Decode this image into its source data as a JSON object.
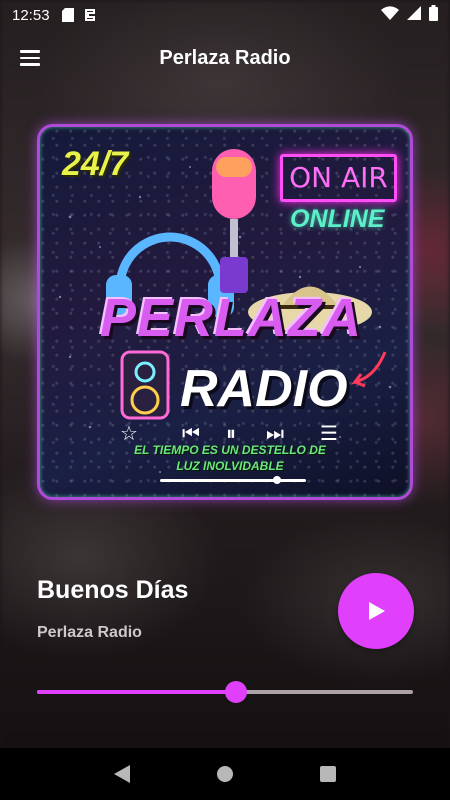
{
  "status_bar": {
    "time": "12:53",
    "icons": [
      "sd-card-icon",
      "sync-icon",
      "wifi-icon",
      "signal-icon",
      "battery-icon"
    ]
  },
  "app_bar": {
    "title": "Perlaza Radio",
    "menu_icon": "menu-icon"
  },
  "artwork": {
    "badge": "24/7",
    "on_air": "ON AIR",
    "online": "ONLINE",
    "brand_line1": "PERLAZA",
    "brand_line2": "RADIO",
    "tagline": "EL TIEMPO ES UN DESTELLO DE LUZ INOLVIDABLE"
  },
  "now_playing": {
    "title": "Buenos Días",
    "artist": "Perlaza Radio",
    "play_icon": "play-icon",
    "progress": 0.53
  },
  "colors": {
    "accent": "#e040fb",
    "nav_bar": "#000000"
  },
  "nav_bar": {
    "icons": [
      "back-icon",
      "home-icon",
      "recents-icon"
    ]
  }
}
